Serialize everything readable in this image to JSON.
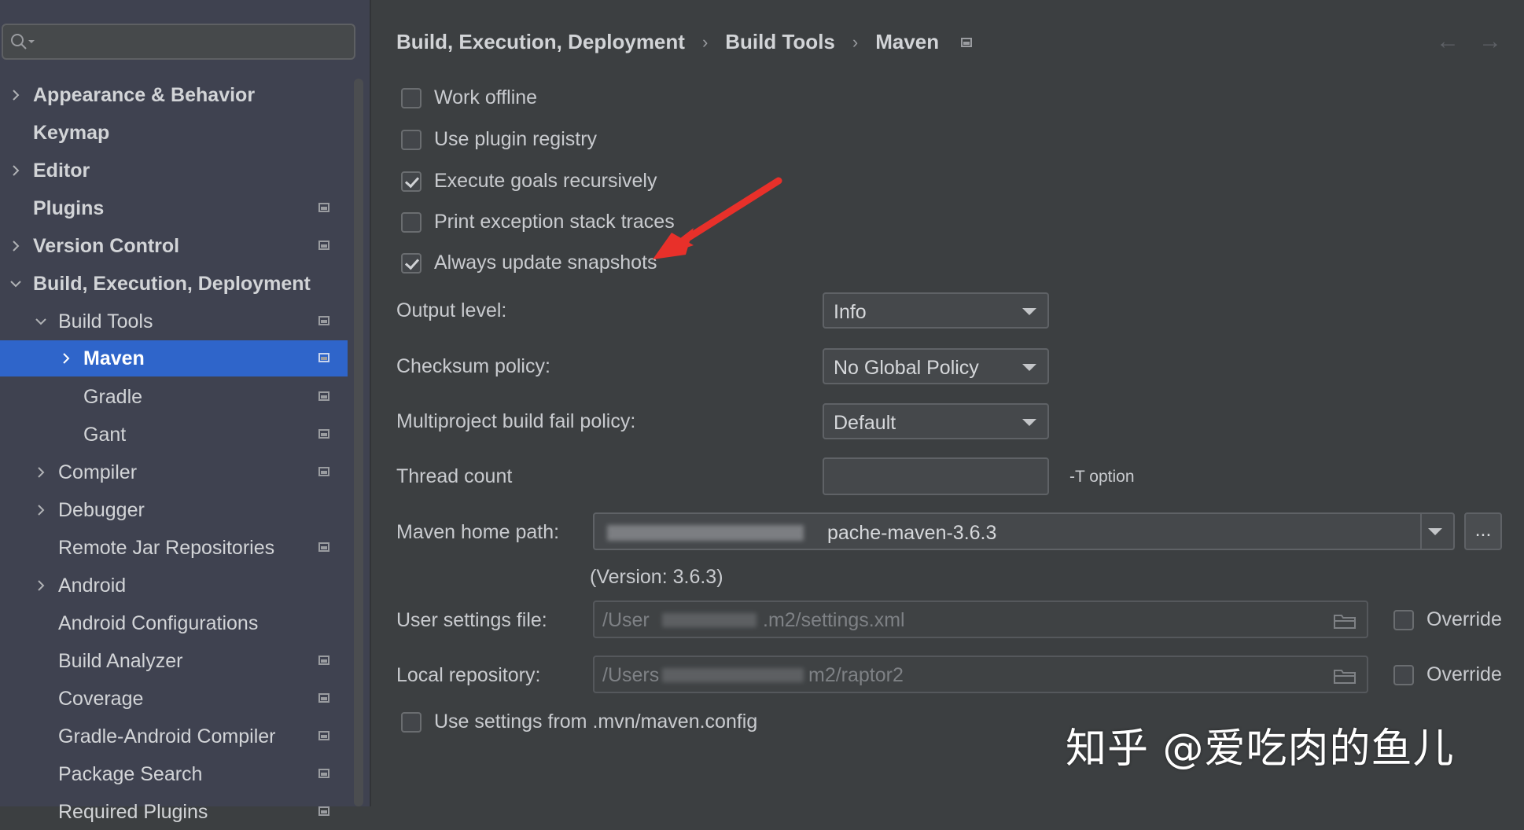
{
  "search": {
    "placeholder": ""
  },
  "sidebar": {
    "items": [
      {
        "label": "Appearance & Behavior"
      },
      {
        "label": "Keymap"
      },
      {
        "label": "Editor"
      },
      {
        "label": "Plugins"
      },
      {
        "label": "Version Control"
      },
      {
        "label": "Build, Execution, Deployment"
      },
      {
        "label": "Build Tools"
      },
      {
        "label": "Maven"
      },
      {
        "label": "Gradle"
      },
      {
        "label": "Gant"
      },
      {
        "label": "Compiler"
      },
      {
        "label": "Debugger"
      },
      {
        "label": "Remote Jar Repositories"
      },
      {
        "label": "Android"
      },
      {
        "label": "Android Configurations"
      },
      {
        "label": "Build Analyzer"
      },
      {
        "label": "Coverage"
      },
      {
        "label": "Gradle-Android Compiler"
      },
      {
        "label": "Package Search"
      },
      {
        "label": "Required Plugins"
      }
    ]
  },
  "breadcrumb": [
    "Build, Execution, Deployment",
    "Build Tools",
    "Maven"
  ],
  "checkboxes": {
    "work_offline": {
      "label": "Work offline",
      "checked": false
    },
    "use_plugin_registry": {
      "label": "Use plugin registry",
      "checked": false
    },
    "execute_goals": {
      "label": "Execute goals recursively",
      "checked": true
    },
    "print_exception": {
      "label": "Print exception stack traces",
      "checked": false
    },
    "always_update": {
      "label": "Always update snapshots",
      "checked": true
    },
    "use_settings_mvn": {
      "label": "Use settings from .mvn/maven.config",
      "checked": false
    }
  },
  "fields": {
    "output_level": {
      "label": "Output level:",
      "value": "Info"
    },
    "checksum_policy": {
      "label": "Checksum policy:",
      "value": "No Global Policy"
    },
    "multiproject_fail": {
      "label": "Multiproject build fail policy:",
      "value": "Default"
    },
    "thread_count": {
      "label": "Thread count",
      "value": "",
      "hint": "-T option"
    },
    "maven_home": {
      "label": "Maven home path:",
      "value": "pache-maven-3.6.3",
      "browse": "...",
      "version": "(Version: 3.6.3)"
    },
    "user_settings": {
      "label": "User settings file:",
      "value": "/User",
      "value_tail": ".m2/settings.xml",
      "override": "Override"
    },
    "local_repo": {
      "label": "Local repository:",
      "value": "/Users",
      "value_tail": "m2/raptor2",
      "override": "Override"
    }
  },
  "watermark": "知乎 @爱吃肉的鱼儿",
  "colors": {
    "accent_selected": "#2f65ca",
    "annotation_arrow": "#e8302a"
  }
}
